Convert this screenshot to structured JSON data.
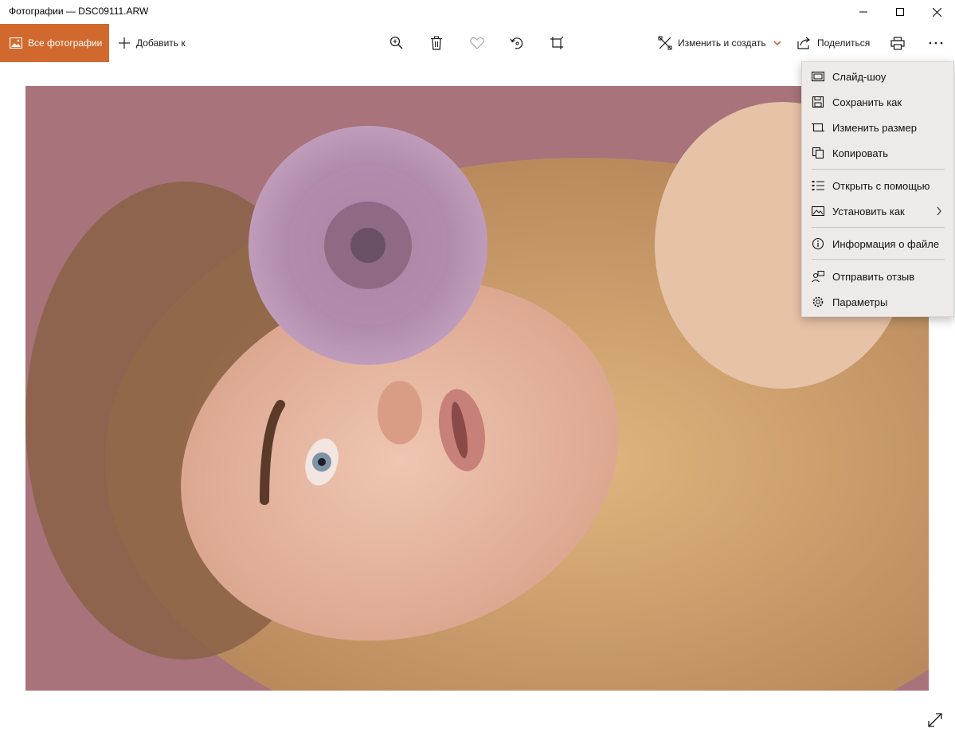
{
  "window": {
    "title": "Фотографии — DSC09111.ARW"
  },
  "toolbar": {
    "all_photos_label": "Все фотографии",
    "add_to_label": "Добавить к",
    "edit_create_label": "Изменить и создать",
    "share_label": "Поделиться"
  },
  "menu": {
    "items": [
      {
        "label": "Слайд-шоу",
        "icon": "slideshow-icon"
      },
      {
        "label": "Сохранить как",
        "icon": "save-icon"
      },
      {
        "label": "Изменить размер",
        "icon": "resize-icon"
      },
      {
        "label": "Копировать",
        "icon": "copy-icon"
      },
      {
        "label": "Открыть с помощью",
        "icon": "open-with-icon"
      },
      {
        "label": "Установить как",
        "icon": "set-as-icon"
      },
      {
        "label": "Информация о файле",
        "icon": "info-icon"
      },
      {
        "label": "Отправить отзыв",
        "icon": "feedback-icon"
      },
      {
        "label": "Параметры",
        "icon": "settings-icon"
      }
    ]
  },
  "colors": {
    "accent": "#d1692e",
    "menu_bg": "#eeeae7"
  }
}
